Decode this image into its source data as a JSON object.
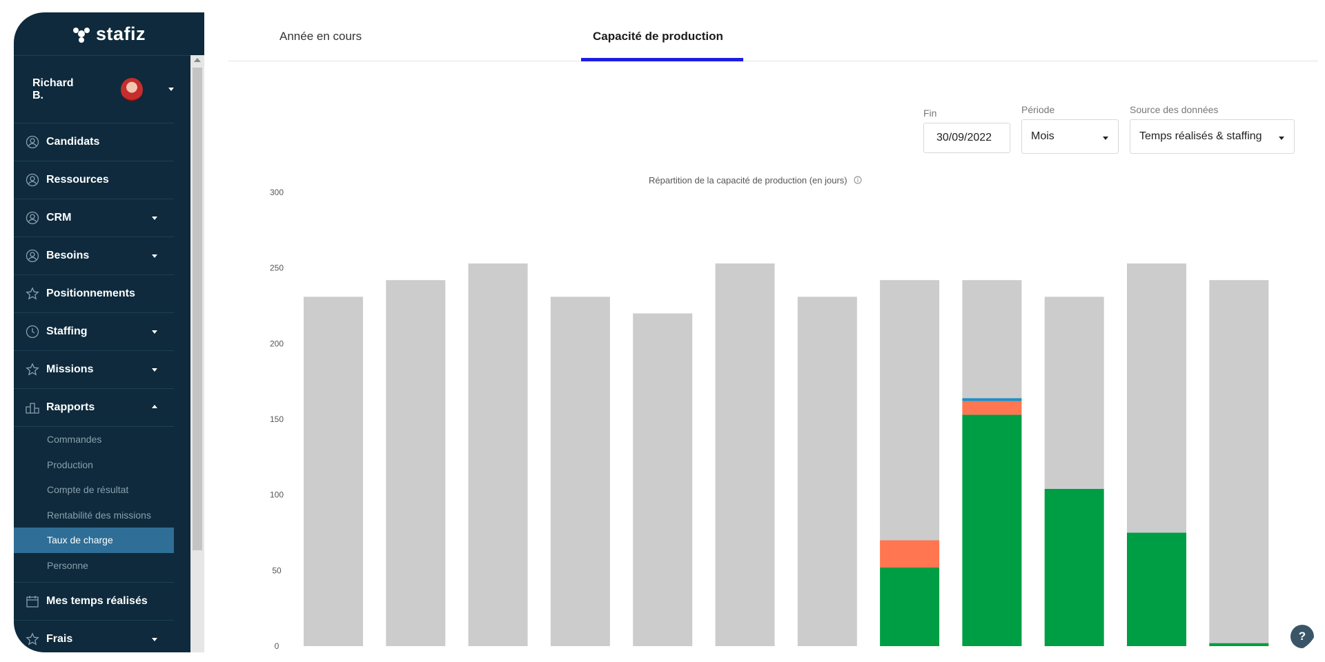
{
  "app": {
    "logo_text": "stafiz"
  },
  "user": {
    "name": "Richard B."
  },
  "menu": [
    {
      "label": "Candidats",
      "icon": "user-circle-icon",
      "dropdown": false
    },
    {
      "label": "Ressources",
      "icon": "user-circle-icon",
      "dropdown": false
    },
    {
      "label": "CRM",
      "icon": "user-circle-icon",
      "dropdown": true
    },
    {
      "label": "Besoins",
      "icon": "user-circle-icon",
      "dropdown": true
    },
    {
      "label": "Positionnements",
      "icon": "star-icon",
      "dropdown": false
    },
    {
      "label": "Staffing",
      "icon": "clock-icon",
      "dropdown": true
    },
    {
      "label": "Missions",
      "icon": "star-icon",
      "dropdown": true
    },
    {
      "label": "Rapports",
      "icon": "podium-icon",
      "dropdown": true,
      "expanded": true
    }
  ],
  "submenu": [
    {
      "label": "Commandes"
    },
    {
      "label": "Production"
    },
    {
      "label": "Compte de résultat"
    },
    {
      "label": "Rentabilité des missions"
    },
    {
      "label": "Taux de charge",
      "active": true
    },
    {
      "label": "Personne"
    }
  ],
  "menu_bottom": [
    {
      "label": "Mes temps réalisés",
      "icon": "calendar-icon",
      "dropdown": false
    },
    {
      "label": "Frais",
      "icon": "star-icon",
      "dropdown": true
    }
  ],
  "tabs": [
    {
      "label": "Année en cours",
      "active": false
    },
    {
      "label": "Capacité de production",
      "active": true
    }
  ],
  "filters": {
    "fin_label": "Fin",
    "fin_value": "30/09/2022",
    "periode_label": "Période",
    "periode_value": "Mois",
    "source_label": "Source des données",
    "source_value": "Temps réalisés & staffing"
  },
  "colors": {
    "sidebar_bg": "#0e2a3c",
    "active_item": "#2f6e96",
    "tab_accent": "#1d1de0",
    "remaining": "#cccccc",
    "green": "#009e44",
    "orange": "#ff7651",
    "blue": "#1f8fc5"
  },
  "chart_data": {
    "type": "bar",
    "stacked": true,
    "title": "Répartition de la capacité de production (en jours)",
    "ylim": [
      0,
      300
    ],
    "yticks": [
      0,
      50,
      100,
      150,
      200,
      250,
      300
    ],
    "grid": false,
    "n_bars": 12,
    "series": [
      {
        "color": "#009e44",
        "values": [
          0,
          0,
          0,
          0,
          0,
          0,
          0,
          52,
          153,
          104,
          75,
          2
        ]
      },
      {
        "color": "#ff7651",
        "values": [
          0,
          0,
          0,
          0,
          0,
          0,
          0,
          18,
          9,
          0,
          0,
          0
        ]
      },
      {
        "color": "#1f8fc5",
        "values": [
          0,
          0,
          0,
          0,
          0,
          0,
          0,
          0,
          2,
          0,
          0,
          0
        ]
      },
      {
        "color": "#cccccc",
        "values": [
          231,
          242,
          253,
          231,
          220,
          253,
          231,
          172,
          78,
          127,
          178,
          240
        ]
      }
    ]
  }
}
